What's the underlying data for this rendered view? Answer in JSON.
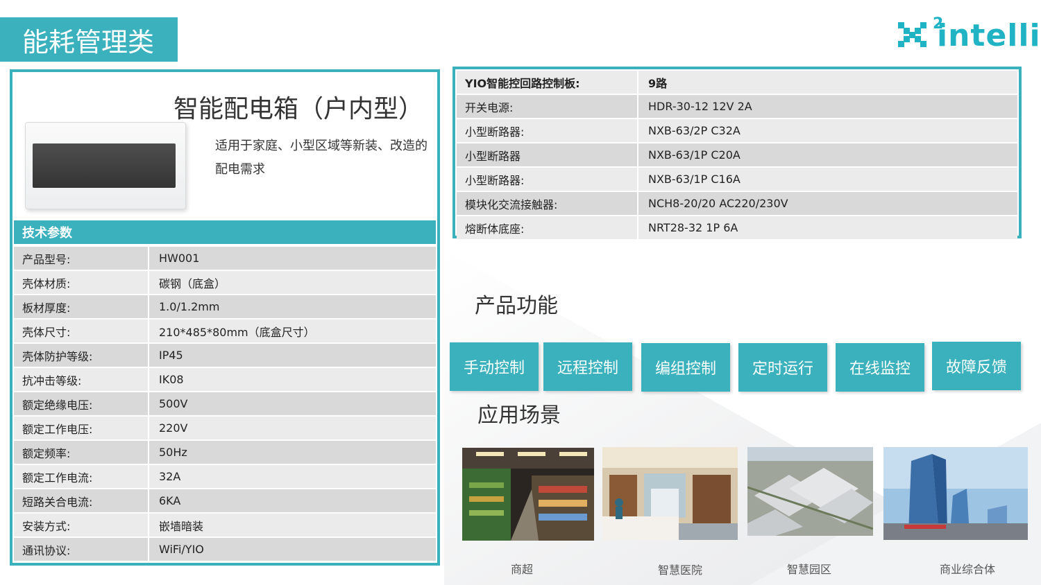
{
  "category": "能耗管理类",
  "logo": {
    "text": "intelli",
    "superscript": "2",
    "brand_color": "#1fb3c4"
  },
  "accent_color": "#3ab1bd",
  "product": {
    "title": "智能配电箱（户内型）",
    "description": "适用于家庭、小型区域等新装、改造的配电需求",
    "image_icon": "distribution-box-image"
  },
  "spec_header": "技术参数",
  "specs": [
    {
      "k": "产品型号:",
      "v": "HW001"
    },
    {
      "k": "壳体材质:",
      "v": "碳钢（底盒）"
    },
    {
      "k": "板材厚度:",
      "v": "1.0/1.2mm"
    },
    {
      "k": "壳体尺寸:",
      "v": "210*485*80mm（底盒尺寸）"
    },
    {
      "k": "壳体防护等级:",
      "v": "IP45"
    },
    {
      "k": "抗冲击等级:",
      "v": "IK08"
    },
    {
      "k": "额定绝缘电压:",
      "v": "500V"
    },
    {
      "k": "额定工作电压:",
      "v": "220V"
    },
    {
      "k": "额定频率:",
      "v": "50Hz"
    },
    {
      "k": "额定工作电流:",
      "v": "32A"
    },
    {
      "k": "短路关合电流:",
      "v": "6KA"
    },
    {
      "k": "安装方式:",
      "v": "嵌墙暗装"
    },
    {
      "k": "通讯协议:",
      "v": "WiFi/YIO"
    }
  ],
  "components": [
    {
      "k": "YIO智能控回路控制板:",
      "v": "9路"
    },
    {
      "k": "开关电源:",
      "v": "HDR-30-12 12V 2A"
    },
    {
      "k": "小型断路器:",
      "v": "NXB-63/2P C32A"
    },
    {
      "k": "小型断路器",
      "v": "NXB-63/1P C20A"
    },
    {
      "k": "小型断路器:",
      "v": "NXB-63/1P C16A"
    },
    {
      "k": "模块化交流接触器:",
      "v": "NCH8-20/20 AC220/230V"
    },
    {
      "k": "熔断体底座:",
      "v": "NRT28-32 1P 6A"
    }
  ],
  "functions_title": "产品功能",
  "functions": [
    "手动控制",
    "远程控制",
    "编组控制",
    "定时运行",
    "在线监控",
    "故障反馈"
  ],
  "scenes_title": "应用场景",
  "scenes": [
    {
      "label": "商超",
      "icon": "supermarket-photo"
    },
    {
      "label": "智慧医院",
      "icon": "hospital-ward-photo"
    },
    {
      "label": "智慧园区",
      "icon": "industrial-park-photo"
    },
    {
      "label": "商业综合体",
      "icon": "commercial-complex-photo"
    }
  ]
}
